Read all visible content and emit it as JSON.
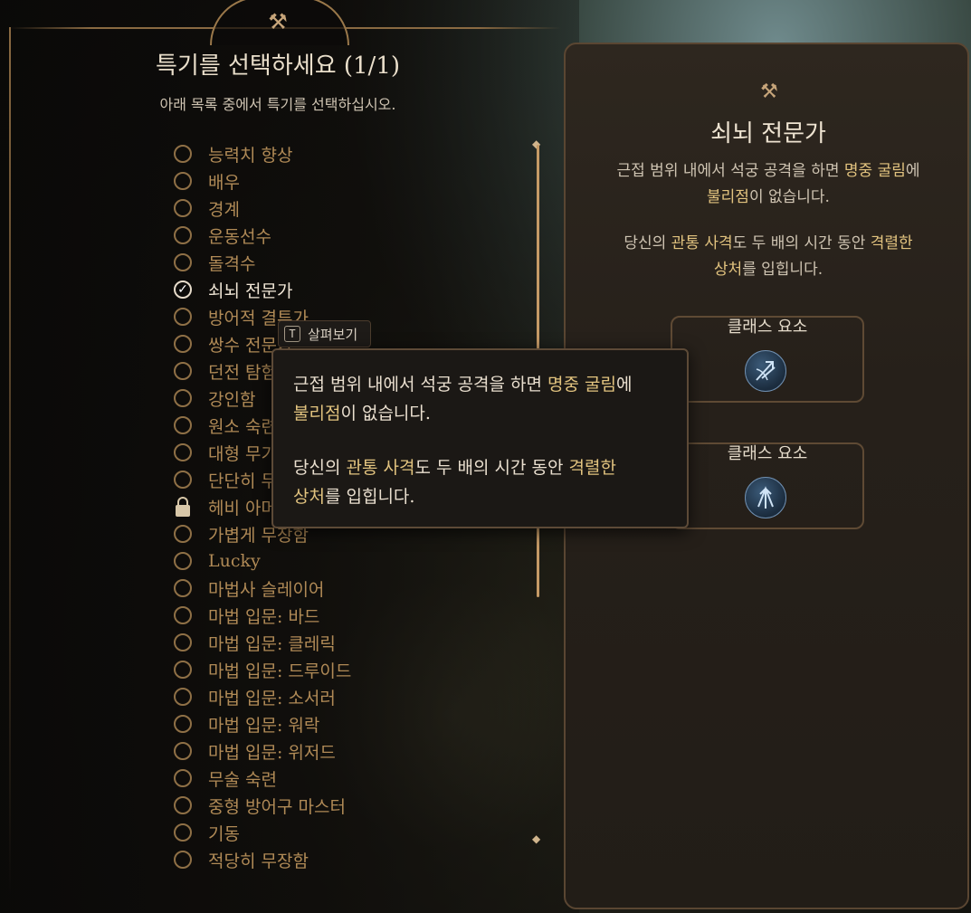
{
  "header": {
    "title": "특기를 선택하세요 (1/1)",
    "subtitle": "아래 목록 중에서 특기를 선택하십시오."
  },
  "feats": [
    {
      "label": "능력치 향상",
      "state": "unselected"
    },
    {
      "label": "배우",
      "state": "unselected"
    },
    {
      "label": "경계",
      "state": "unselected"
    },
    {
      "label": "운동선수",
      "state": "unselected"
    },
    {
      "label": "돌격수",
      "state": "unselected"
    },
    {
      "label": "쇠뇌 전문가",
      "state": "selected"
    },
    {
      "label": "방어적 결투가",
      "state": "unselected"
    },
    {
      "label": "쌍수 전문가",
      "state": "unselected"
    },
    {
      "label": "던전 탐험가",
      "state": "unselected"
    },
    {
      "label": "강인함",
      "state": "unselected"
    },
    {
      "label": "원소 숙련",
      "state": "unselected"
    },
    {
      "label": "대형 무기 달인",
      "state": "unselected"
    },
    {
      "label": "단단히 무장함",
      "state": "unselected"
    },
    {
      "label": "헤비 아머 마스터",
      "state": "locked"
    },
    {
      "label": "가볍게 무장함",
      "state": "unselected"
    },
    {
      "label": "Lucky",
      "state": "unselected"
    },
    {
      "label": "마법사 슬레이어",
      "state": "unselected"
    },
    {
      "label": "마법 입문: 바드",
      "state": "unselected"
    },
    {
      "label": "마법 입문: 클레릭",
      "state": "unselected"
    },
    {
      "label": "마법 입문: 드루이드",
      "state": "unselected"
    },
    {
      "label": "마법 입문: 소서러",
      "state": "unselected"
    },
    {
      "label": "마법 입문: 워락",
      "state": "unselected"
    },
    {
      "label": "마법 입문: 위저드",
      "state": "unselected"
    },
    {
      "label": "무술 숙련",
      "state": "unselected"
    },
    {
      "label": "중형 방어구 마스터",
      "state": "unselected"
    },
    {
      "label": "기동",
      "state": "unselected"
    },
    {
      "label": "적당히 무장함",
      "state": "unselected"
    }
  ],
  "preview": {
    "key": "T",
    "label": "살펴보기"
  },
  "tooltip": {
    "p1_pre": "근접 범위 내에서 석궁 공격을 하면 ",
    "p1_hl1": "명중 굴림",
    "p1_post": "에",
    "p1_hl2": "불리점",
    "p1_end": "이 없습니다.",
    "p2_pre": "당신의 ",
    "p2_hl1": "관통 사격",
    "p2_mid": "도 두 배의 시간 동안 ",
    "p2_hl2": "격렬한",
    "p2_hl3": "상처",
    "p2_end": "를 입힙니다."
  },
  "detail": {
    "title": "쇠뇌 전문가",
    "p1_pre": "근접 범위 내에서 석궁 공격을 하면 ",
    "p1_hl1": "명중 굴림",
    "p1_post": "에",
    "p1_hl2": "불리점",
    "p1_end": "이 없습니다.",
    "p2_pre": "당신의 ",
    "p2_hl1": "관통 사격",
    "p2_mid": "도 두 배의 시간 동안 ",
    "p2_hl2": "격렬한",
    "p2_hl3": "상처",
    "p2_end": "를 입힙니다.",
    "class_boxes": [
      {
        "label": "클래스 요소",
        "icon": "crossbow-class-icon"
      },
      {
        "label": "클래스 요소",
        "icon": "arrows-class-icon"
      }
    ]
  },
  "colors": {
    "accent": "#b08a56",
    "highlight": "#e2c37f",
    "text": "#eadfcb"
  }
}
